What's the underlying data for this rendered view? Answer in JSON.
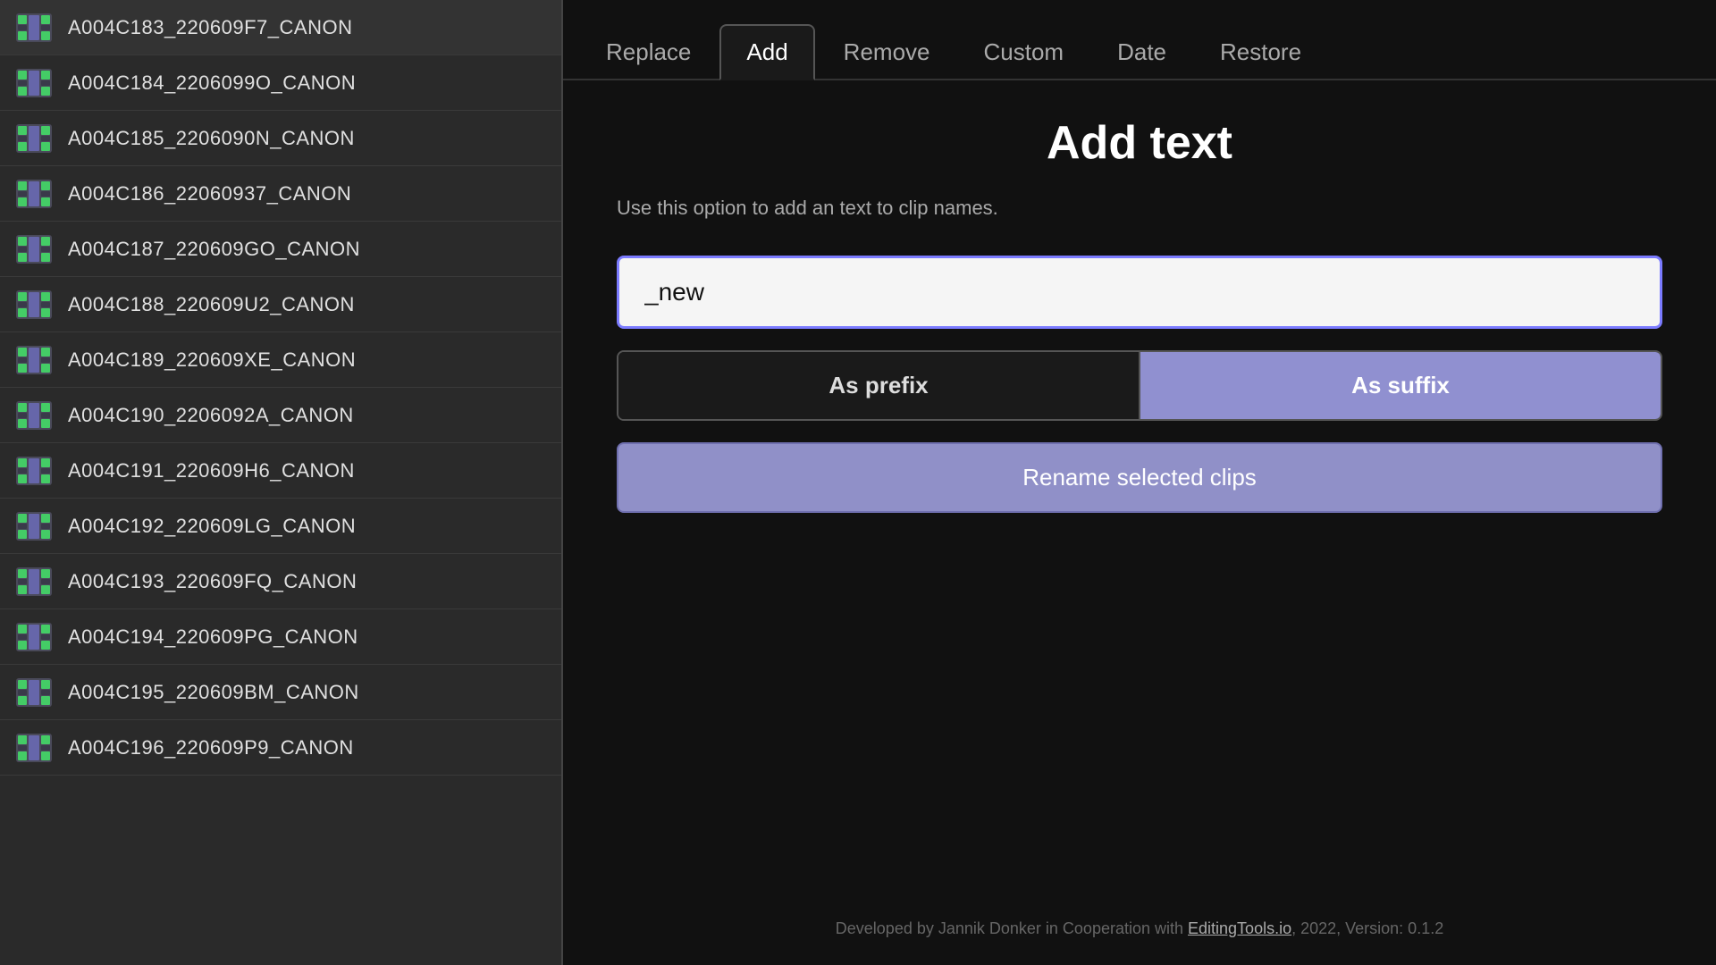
{
  "clips": [
    {
      "id": 1,
      "name": "A004C183_220609F7_CANON"
    },
    {
      "id": 2,
      "name": "A004C184_2206099O_CANON"
    },
    {
      "id": 3,
      "name": "A004C185_2206090N_CANON"
    },
    {
      "id": 4,
      "name": "A004C186_22060937_CANON"
    },
    {
      "id": 5,
      "name": "A004C187_220609GO_CANON"
    },
    {
      "id": 6,
      "name": "A004C188_220609U2_CANON"
    },
    {
      "id": 7,
      "name": "A004C189_220609XE_CANON"
    },
    {
      "id": 8,
      "name": "A004C190_2206092A_CANON"
    },
    {
      "id": 9,
      "name": "A004C191_220609H6_CANON"
    },
    {
      "id": 10,
      "name": "A004C192_220609LG_CANON"
    },
    {
      "id": 11,
      "name": "A004C193_220609FQ_CANON"
    },
    {
      "id": 12,
      "name": "A004C194_220609PG_CANON"
    },
    {
      "id": 13,
      "name": "A004C195_220609BM_CANON"
    },
    {
      "id": 14,
      "name": "A004C196_220609P9_CANON"
    }
  ],
  "tabs": [
    {
      "id": "replace",
      "label": "Replace",
      "active": false
    },
    {
      "id": "add",
      "label": "Add",
      "active": true
    },
    {
      "id": "remove",
      "label": "Remove",
      "active": false
    },
    {
      "id": "custom",
      "label": "Custom",
      "active": false
    },
    {
      "id": "date",
      "label": "Date",
      "active": false
    },
    {
      "id": "restore",
      "label": "Restore",
      "active": false
    }
  ],
  "content": {
    "title": "Add text",
    "description": "Use this option to add an text to clip names.",
    "input_value": "_new",
    "input_placeholder": "",
    "prefix_label": "As prefix",
    "suffix_label": "As suffix",
    "rename_label": "Rename selected clips"
  },
  "footer": {
    "text": "Developed by Jannik Donker in Cooperation with EditingTools.io, 2022, Version: 0.1.2",
    "link_text": "EditingTools.io",
    "link_url": "#"
  }
}
